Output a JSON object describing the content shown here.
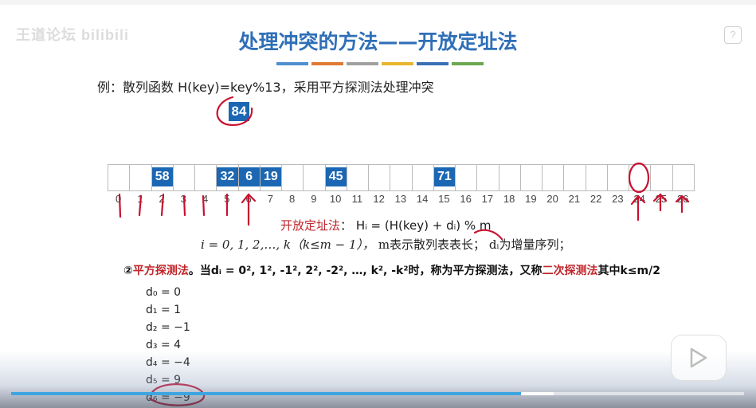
{
  "header": {
    "logo_text": "王道论坛 bilibili",
    "help_icon": "?",
    "title": "处理冲突的方法——开放定址法",
    "stripe_colors": [
      "#4f8fce",
      "#e07a34",
      "#a0a0a0",
      "#e8b62c",
      "#3a6fb5",
      "#6aa84f"
    ]
  },
  "example": {
    "text": "例：散列函数 H(key)=key%13，采用平方探测法处理冲突",
    "incoming_key": "84"
  },
  "hash_table": {
    "slots": [
      {
        "index": "0",
        "key": ""
      },
      {
        "index": "1",
        "key": ""
      },
      {
        "index": "2",
        "key": "58"
      },
      {
        "index": "3",
        "key": ""
      },
      {
        "index": "4",
        "key": ""
      },
      {
        "index": "5",
        "key": "32"
      },
      {
        "index": "6",
        "key": "6"
      },
      {
        "index": "7",
        "key": "19"
      },
      {
        "index": "8",
        "key": ""
      },
      {
        "index": "9",
        "key": ""
      },
      {
        "index": "10",
        "key": "45"
      },
      {
        "index": "11",
        "key": ""
      },
      {
        "index": "12",
        "key": ""
      },
      {
        "index": "13",
        "key": ""
      },
      {
        "index": "14",
        "key": ""
      },
      {
        "index": "15",
        "key": "71"
      },
      {
        "index": "16",
        "key": ""
      },
      {
        "index": "17",
        "key": ""
      },
      {
        "index": "18",
        "key": ""
      },
      {
        "index": "19",
        "key": ""
      },
      {
        "index": "20",
        "key": ""
      },
      {
        "index": "21",
        "key": ""
      },
      {
        "index": "22",
        "key": ""
      },
      {
        "index": "23",
        "key": ""
      },
      {
        "index": "24",
        "key": ""
      },
      {
        "index": "25",
        "key": ""
      },
      {
        "index": "26",
        "key": ""
      }
    ]
  },
  "formula": {
    "label": "开放定址法",
    "colon": "：",
    "expr": "Hᵢ = (H(key) + dᵢ) % m",
    "line2_pre": "i = 0, 1, 2,…, k（k≤m − 1），",
    "line2_m": "m表示散列表表长；",
    "line2_d": "dᵢ为增量序列；"
  },
  "rule": {
    "prefix": "②",
    "name": "平方探测法",
    "text1": "。当dᵢ = 0², 1², -1², 2², -2², …, k², -k²时，称为平方探测法，又称",
    "name2": "二次探测法",
    "text2": "其中k≤m/2"
  },
  "d_sequence": [
    "d₀ = 0",
    "d₁ = 1",
    "d₂ = −1",
    "d₃ = 4",
    "d₄ = −4",
    "d₅ = 9",
    "d₆ = −9"
  ],
  "player": {
    "progress": 0.696,
    "buffered": 0.74,
    "progress_color": "#3da5e0"
  }
}
